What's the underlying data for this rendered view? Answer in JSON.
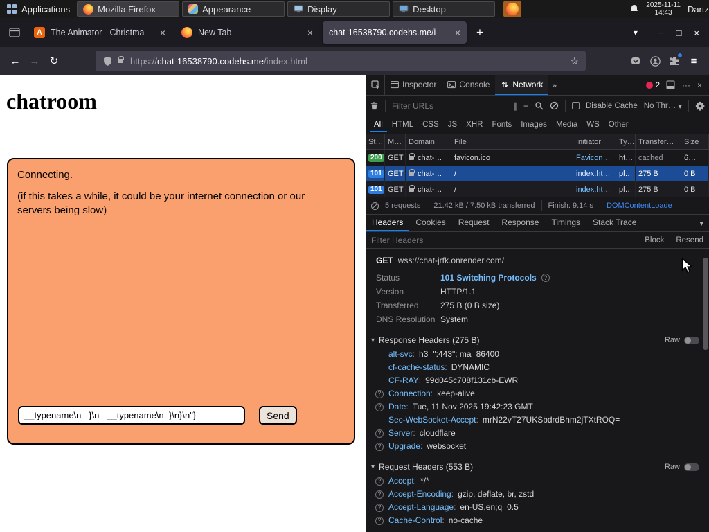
{
  "icons": {
    "close": "×",
    "plus": "+",
    "back": "←",
    "forward": "→",
    "reload": "↻",
    "star": "☆",
    "menu": "≡",
    "chevron_down": "▾",
    "more": "»",
    "meatball": "···",
    "minimize": "−",
    "maximize": "□",
    "pause": "∥",
    "help": "?"
  },
  "taskbar": {
    "applications": "Applications",
    "windows": [
      "Mozilla Firefox",
      "Appearance",
      "Display",
      "Desktop"
    ],
    "clock_date": "2025-11-11",
    "clock_time": "14:43",
    "user": "Dartz"
  },
  "browser": {
    "tabs": [
      {
        "favicon_letter": "A",
        "title": "The Animator - Christma"
      },
      {
        "title": "New Tab"
      },
      {
        "title": "chat-16538790.codehs.me/i"
      }
    ],
    "url": {
      "scheme": "https://",
      "host": "chat-16538790.codehs.me",
      "path": "/index.html"
    }
  },
  "page": {
    "heading": "chatroom",
    "connecting": "Connecting.",
    "note": "(if this takes a while, it could be your internet connection or our servers being slow)",
    "input_value": "__typename\\n   }\\n   __typename\\n  }\\n}\\n\"}",
    "send_label": "Send"
  },
  "devtools": {
    "panel_tabs": [
      "Inspector",
      "Console",
      "Network"
    ],
    "error_count": "2",
    "toolbar": {
      "filter_urls_placeholder": "Filter URLs",
      "disable_cache_label": "Disable Cache",
      "throttling_label": "No Thr…"
    },
    "filters": [
      {
        "label": "All",
        "active": true
      },
      {
        "label": "HTML"
      },
      {
        "label": "CSS"
      },
      {
        "label": "JS"
      },
      {
        "label": "XHR"
      },
      {
        "label": "Fonts"
      },
      {
        "label": "Images"
      },
      {
        "label": "Media"
      },
      {
        "label": "WS"
      },
      {
        "label": "Other"
      }
    ],
    "network": {
      "columns": [
        "St…",
        "M…",
        "Domain",
        "File",
        "Initiator",
        "Ty…",
        "Transfer…",
        "Size"
      ],
      "rows": [
        {
          "status": "200",
          "method": "GET",
          "domain": "chat-…",
          "file": "favicon.ico",
          "initiator": "Favicon…",
          "type": "ht…",
          "transferred": "cached",
          "size": "6…"
        },
        {
          "status": "101",
          "method": "GET",
          "domain": "chat-…",
          "file": "/",
          "initiator": "index.ht…",
          "type": "pl…",
          "transferred": "275 B",
          "size": "0 B"
        },
        {
          "status": "101",
          "method": "GET",
          "domain": "chat-…",
          "file": "/",
          "initiator": "index.ht…",
          "type": "pl…",
          "transferred": "275 B",
          "size": "0 B"
        }
      ]
    },
    "summary": {
      "requests": "5 requests",
      "transferred": "21.42 kB / 7.50 kB transferred",
      "finish": "Finish: 9.14 s",
      "dom_event": "DOMContentLoade"
    },
    "detail_tabs": [
      {
        "label": "Headers",
        "active": true
      },
      {
        "label": "Cookies"
      },
      {
        "label": "Request"
      },
      {
        "label": "Response"
      },
      {
        "label": "Timings"
      },
      {
        "label": "Stack Trace"
      }
    ],
    "headers": {
      "filter_placeholder": "Filter Headers",
      "block_label": "Block",
      "resend_label": "Resend",
      "method": "GET",
      "url": "wss://chat-jrfk.onrender.com/",
      "summary": [
        {
          "label": "Status",
          "value": "101 Switching Protocols"
        },
        {
          "label": "Version",
          "value": "HTTP/1.1"
        },
        {
          "label": "Transferred",
          "value": "275 B (0 B size)"
        },
        {
          "label": "DNS Resolution",
          "value": "System"
        }
      ],
      "response_section": {
        "title": "Response Headers (275 B)",
        "raw_label": "Raw"
      },
      "response_headers": [
        {
          "name": "alt-svc",
          "value": "h3=\":443\"; ma=86400",
          "help": false
        },
        {
          "name": "cf-cache-status",
          "value": "DYNAMIC",
          "help": false
        },
        {
          "name": "CF-RAY",
          "value": "99d045c708f131cb-EWR",
          "help": false
        },
        {
          "name": "Connection",
          "value": "keep-alive",
          "help": true
        },
        {
          "name": "Date",
          "value": "Tue, 11 Nov 2025 19:42:23 GMT",
          "help": true
        },
        {
          "name": "Sec-WebSocket-Accept",
          "value": "mrN22vT27UKSbdrdBhm2jTXtROQ=",
          "help": false
        },
        {
          "name": "Server",
          "value": "cloudflare",
          "help": true
        },
        {
          "name": "Upgrade",
          "value": "websocket",
          "help": true
        }
      ],
      "request_section": {
        "title": "Request Headers (553 B)",
        "raw_label": "Raw"
      },
      "request_headers": [
        {
          "name": "Accept",
          "value": "*/*",
          "help": true
        },
        {
          "name": "Accept-Encoding",
          "value": "gzip, deflate, br, zstd",
          "help": true
        },
        {
          "name": "Accept-Language",
          "value": "en-US,en;q=0.5",
          "help": true
        },
        {
          "name": "Cache-Control",
          "value": "no-cache",
          "help": true
        }
      ]
    }
  }
}
